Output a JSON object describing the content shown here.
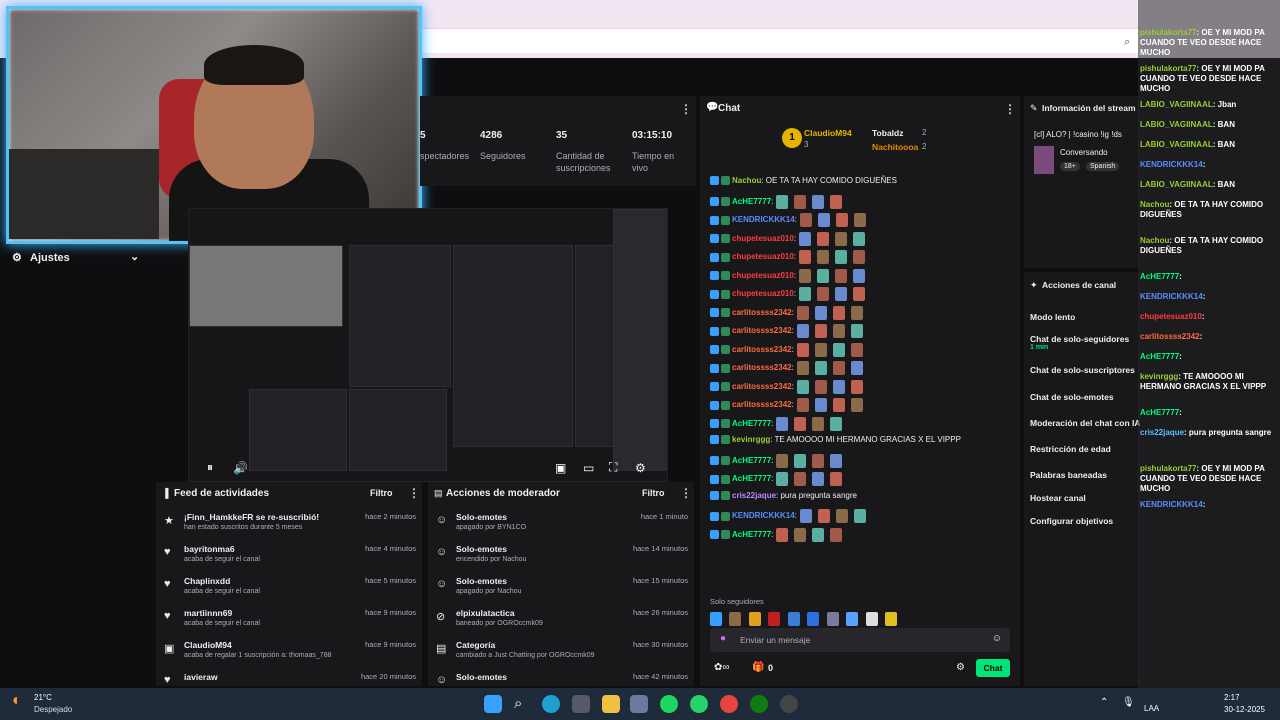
{
  "browser": {
    "zoom_icon": "zoom-icon"
  },
  "stats": {
    "items": [
      {
        "value": "5",
        "label": "spectadores"
      },
      {
        "value": "4286",
        "label": "Seguidores"
      },
      {
        "value": "35",
        "label": "Cantidad de suscripciones"
      },
      {
        "value": "03:15:10",
        "label": "Tiempo en vivo"
      }
    ]
  },
  "sidebar": {
    "settings_label": "Ajustes"
  },
  "chat": {
    "title": "Chat",
    "leaderboard": [
      {
        "rank": "1",
        "name": "ClaudioM94",
        "count": "3"
      },
      {
        "name": "Tobaldz",
        "count": "2"
      },
      {
        "name": "Nachitoooa",
        "count": "2"
      }
    ],
    "messages": [
      {
        "user": "Nachou",
        "text": ": OE TA TA HAY COMIDO DIGUEÑES",
        "color": "#9acd32"
      },
      {
        "user": "AcHE7777",
        "text": ":",
        "color": "#00ff7f"
      },
      {
        "user": "KENDRICKKK14",
        "text": ":",
        "color": "#5b8cff"
      },
      {
        "user": "chupetesuaz010",
        "text": ":",
        "color": "#ff3b3b"
      },
      {
        "user": "chupetesuaz010",
        "text": ":",
        "color": "#ff3b3b"
      },
      {
        "user": "chupetesuaz010",
        "text": ":",
        "color": "#ff3b3b"
      },
      {
        "user": "chupetesuaz010",
        "text": ":",
        "color": "#ff3b3b"
      },
      {
        "user": "carlitossss2342",
        "text": ":",
        "color": "#ff6a3d"
      },
      {
        "user": "carlitossss2342",
        "text": ":",
        "color": "#ff6a3d"
      },
      {
        "user": "carlitossss2342",
        "text": ":",
        "color": "#ff6a3d"
      },
      {
        "user": "carlitossss2342",
        "text": ":",
        "color": "#ff6a3d"
      },
      {
        "user": "carlitossss2342",
        "text": ":",
        "color": "#ff6a3d"
      },
      {
        "user": "carlitossss2342",
        "text": ":",
        "color": "#ff6a3d"
      },
      {
        "user": "AcHE7777",
        "text": ":",
        "color": "#00ff7f"
      },
      {
        "user": "kevinrggg",
        "text": ": TE AMOOOO MI HERMANO GRACIAS X EL VIPPP",
        "color": "#9acd32"
      },
      {
        "user": "AcHE7777",
        "text": ":",
        "color": "#00ff7f"
      },
      {
        "user": "AcHE7777",
        "text": ":",
        "color": "#00ff7f"
      },
      {
        "user": "cris22jaque",
        "text": ": pura pregunta sangre",
        "color": "#b98cff"
      },
      {
        "user": "KENDRICKKK14",
        "text": ":",
        "color": "#5b8cff"
      },
      {
        "user": "AcHE7777",
        "text": ":",
        "color": "#00ff7f"
      }
    ],
    "mode_label": "Solo seguidores",
    "input_placeholder": "Enviar un mensaje",
    "points": "0",
    "send_label": "Chat"
  },
  "info": {
    "title": "Información del stream",
    "stream_title": "[cl] ALO? | !casino !ig !ds",
    "category": "Conversando",
    "tags": [
      "18+",
      "Spanish"
    ]
  },
  "channel_actions": {
    "title": "Acciones de canal",
    "items": [
      "Modo lento",
      "Chat de solo-seguidores",
      "Chat de solo-suscriptores",
      "Chat de solo-emotes",
      "Moderación del chat con IA",
      "Restricción de edad",
      "Palabras baneadas",
      "Hostear canal",
      "Configurar objetivos"
    ],
    "follower_min": "1 min"
  },
  "feed": {
    "title": "Feed de actividades",
    "filter_label": "Filtro",
    "items": [
      {
        "title": "¡Finn_HamkkeFR se re-suscribió!",
        "sub": "han estado suscritos durante 5 meses",
        "time": "hace 2 minutos"
      },
      {
        "title": "bayritonma6",
        "sub": "acaba de seguir el canal",
        "time": "hace 4 minutos"
      },
      {
        "title": "Chaplinxdd",
        "sub": "acaba de seguir el canal",
        "time": "hace 5 minutos"
      },
      {
        "title": "martiinnn69",
        "sub": "acaba de seguir el canal",
        "time": "hace 9 minutos"
      },
      {
        "title": "ClaudioM94",
        "sub": "acaba de regalar 1 suscripción a: thomaas_788",
        "time": "hace 9 minutos"
      },
      {
        "title": "iavieraw",
        "sub": "",
        "time": "hace 20 minutos"
      }
    ]
  },
  "mod_actions": {
    "title": "Acciones de moderador",
    "filter_label": "Filtro",
    "items": [
      {
        "title": "Solo-emotes",
        "sub": "apagado por BYN1CO",
        "time": "hace 1 minuto"
      },
      {
        "title": "Solo-emotes",
        "sub": "encendido por Nachou",
        "time": "hace 14 minutos"
      },
      {
        "title": "Solo-emotes",
        "sub": "apagado por Nachou",
        "time": "hace 15 minutos"
      },
      {
        "title": "elpixulatactica",
        "sub": "baneado por OGROccmk09",
        "time": "hace 26 minutos"
      },
      {
        "title": "Categoría",
        "sub": "cambiado a Just Chatting por OGROccmk09",
        "time": "hace 30 minutos"
      },
      {
        "title": "Solo-emotes",
        "sub": "",
        "time": "hace 42 minutos"
      }
    ]
  },
  "overlay_chat": [
    {
      "user": "pishulakorta77",
      "text": ": OE Y MI MOD PA CUANDO TE VEO DESDE HACE MUCHO",
      "color": "#9acd32"
    },
    {
      "user": "pishulakorta77",
      "text": ": OE Y MI MOD PA CUANDO TE VEO DESDE HACE MUCHO",
      "color": "#9acd32"
    },
    {
      "user": "LABIO_VAGIINAAL",
      "text": ": Jban",
      "color": "#9acd32"
    },
    {
      "user": "LABIO_VAGIINAAL",
      "text": ": BAN",
      "color": "#9acd32"
    },
    {
      "user": "LABIO_VAGIINAAL",
      "text": ": BAN",
      "color": "#9acd32"
    },
    {
      "user": "KENDRICKKK14",
      "text": ":",
      "color": "#5b8cff"
    },
    {
      "user": "LABIO_VAGIINAAL",
      "text": ": BAN",
      "color": "#9acd32"
    },
    {
      "user": "Nachou",
      "text": ": OE TA TA HAY COMIDO DIGUEÑES",
      "color": "#9acd32"
    },
    {
      "user": "Nachou",
      "text": ": OE TA TA HAY COMIDO DIGUEÑES",
      "color": "#9acd32"
    },
    {
      "user": "AcHE7777",
      "text": ":",
      "color": "#00ff7f"
    },
    {
      "user": "KENDRICKKK14",
      "text": ":",
      "color": "#5b8cff"
    },
    {
      "user": "chupetesuaz010",
      "text": ":",
      "color": "#ff3b3b"
    },
    {
      "user": "carlitossss2342",
      "text": ":",
      "color": "#ff6a3d"
    },
    {
      "user": "AcHE7777",
      "text": ":",
      "color": "#00ff7f"
    },
    {
      "user": "kevinrggg",
      "text": ": TE AMOOOO MI HERMANO GRACIAS X EL VIPPP",
      "color": "#9acd32"
    },
    {
      "user": "AcHE7777",
      "text": ":",
      "color": "#00ff7f"
    },
    {
      "user": "cris22jaque",
      "text": ": pura pregunta sangre",
      "color": "#5bc0ff"
    },
    {
      "user": "pishulakorta77",
      "text": ": OE Y MI MOD PA CUANDO TE VEO DESDE HACE MUCHO",
      "color": "#9acd32"
    },
    {
      "user": "KENDRICKKK14",
      "text": ":",
      "color": "#5b8cff"
    }
  ],
  "taskbar": {
    "weather_temp": "21°C",
    "weather_desc": "Despejado",
    "time": "2:17",
    "date": "30-12-2025",
    "lang": "LAA"
  }
}
